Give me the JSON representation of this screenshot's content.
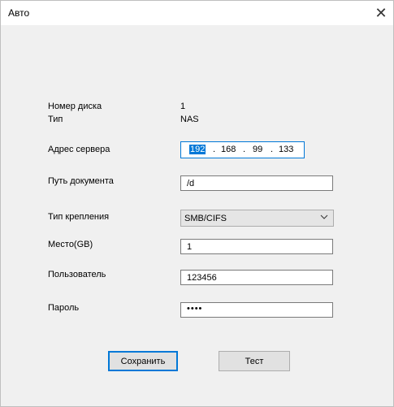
{
  "window": {
    "title": "Авто"
  },
  "form": {
    "disk_number": {
      "label": "Номер диска",
      "value": "1"
    },
    "type": {
      "label": "Тип",
      "value": "NAS"
    },
    "server_address": {
      "label": "Адрес сервера",
      "octets": [
        "192",
        "168",
        "99",
        "133"
      ]
    },
    "document_path": {
      "label": "Путь документа",
      "value": "/d"
    },
    "mount_type": {
      "label": "Тип крепления",
      "value": "SMB/CIFS"
    },
    "space": {
      "label": "Место(GB)",
      "value": "1"
    },
    "user": {
      "label": "Пользователь",
      "value": "123456"
    },
    "password": {
      "label": "Пароль",
      "value": "••••"
    }
  },
  "buttons": {
    "save": "Сохранить",
    "test": "Тест"
  },
  "icons": {
    "close": "close-icon",
    "dropdown": "chevron-down-icon"
  },
  "colors": {
    "accent": "#0078d7",
    "window_bg": "#f0f0f0"
  }
}
